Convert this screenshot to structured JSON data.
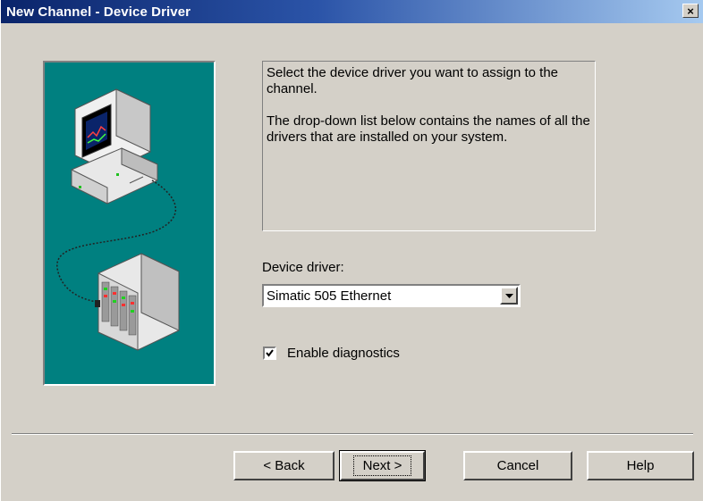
{
  "window": {
    "title": "New Channel - Device Driver",
    "close_label": "×"
  },
  "description": {
    "para1": "Select the device driver you want to assign to the channel.",
    "para2": "The drop-down list below contains the names of all the drivers that are installed on your system."
  },
  "device_driver": {
    "label": "Device driver:",
    "value": "Simatic 505 Ethernet"
  },
  "diagnostics": {
    "label": "Enable diagnostics",
    "checked": true
  },
  "buttons": {
    "back": "< Back",
    "next": "Next >",
    "cancel": "Cancel",
    "help": "Help"
  },
  "icons": [
    "close-icon",
    "computer-icon",
    "plc-device-icon",
    "dropdown-arrow-icon",
    "checkmark-icon"
  ],
  "colors": {
    "titlebar_start": "#0a246a",
    "titlebar_end": "#a6caf0",
    "dialog_bg": "#d4d0c8",
    "illustration_bg": "#008080"
  }
}
